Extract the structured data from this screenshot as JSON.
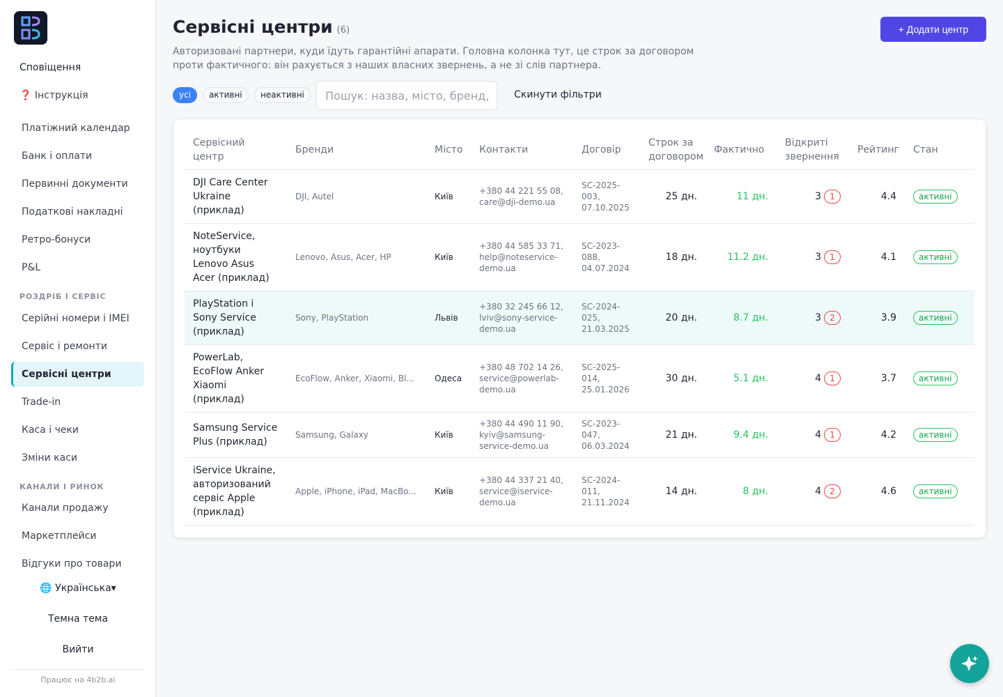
{
  "sidebar": {
    "notifications_label": "Сповіщення",
    "instructions_label": "❓ Інструкція",
    "finance_items": [
      {
        "label": "Платіжний календар"
      },
      {
        "label": "Банк і оплати"
      },
      {
        "label": "Первинні документи"
      },
      {
        "label": "Податкові накладні"
      },
      {
        "label": "Ретро-бонуси"
      },
      {
        "label": "P&L"
      }
    ],
    "section_retail": "РОЗДРІБ І СЕРВІС",
    "retail_items": [
      {
        "label": "Серійні номери і IMEI"
      },
      {
        "label": "Сервіс і ремонти"
      },
      {
        "label": "Сервісні центри"
      },
      {
        "label": "Trade-in"
      },
      {
        "label": "Каса і чеки"
      },
      {
        "label": "Зміни каси"
      }
    ],
    "section_channels": "КАНАЛИ І РИНОК",
    "channel_items": [
      {
        "label": "Канали продажу"
      },
      {
        "label": "Маркетплейси"
      },
      {
        "label": "Відгуки про товари"
      }
    ],
    "language": "🌐 Українська▾",
    "theme_label": "Темна тема",
    "logout_label": "Вийти",
    "powered_by": "Працює на 4b2b.ai"
  },
  "header": {
    "title": "Сервісні центри",
    "count": "(6)",
    "add_button": "+ Додати центр",
    "subtitle": "Авторизовані партнери, куди їдуть гарантійні апарати. Головна колонка тут, це строк за договором проти фактичного: він рахується з наших власних звернень, а не зі слів партнера."
  },
  "filters": {
    "chips": [
      "усі",
      "активні",
      "неактивні"
    ],
    "search_placeholder": "Пошук: назва, місто, бренд, ...",
    "search_value": "",
    "reset_label": "Скинути фільтри"
  },
  "table": {
    "columns": [
      "Сервісний центр",
      "Бренди",
      "Місто",
      "Контакти",
      "Договір",
      "Строк за договором",
      "Фактично",
      "Відкриті звернення",
      "Рейтинг",
      "Стан"
    ],
    "rows": [
      {
        "name": "DJI Care Center Ukraine (приклад)",
        "brands": "DJI, Autel",
        "city": "Київ",
        "contacts": "+380 44 221 55 08, care@dji-demo.ua",
        "contract": "SC-2025-003, 07.10.2025",
        "term": "25 дн.",
        "actual": "11 дн.",
        "open": "3",
        "overdue": "1",
        "rating": "4.4",
        "status": "активні"
      },
      {
        "name": "NoteService, ноутбуки Lenovo Asus Acer (приклад)",
        "brands": "Lenovo, Asus, Acer, HP",
        "city": "Київ",
        "contacts": "+380 44 585 33 71, help@noteservice-demo.ua",
        "contract": "SC-2023-088, 04.07.2024",
        "term": "18 дн.",
        "actual": "11.2 дн.",
        "open": "3",
        "overdue": "1",
        "rating": "4.1",
        "status": "активні"
      },
      {
        "name": "PlayStation і Sony Service (приклад)",
        "brands": "Sony, PlayStation",
        "city": "Львів",
        "contacts": "+380 32 245 66 12, lviv@sony-service-demo.ua",
        "contract": "SC-2024-025, 21.03.2025",
        "term": "20 дн.",
        "actual": "8.7 дн.",
        "open": "3",
        "overdue": "2",
        "rating": "3.9",
        "status": "активні"
      },
      {
        "name": "PowerLab, EcoFlow Anker Xiaomi (приклад)",
        "brands": "EcoFlow, Anker, Xiaomi, Bl...",
        "city": "Одеса",
        "contacts": "+380 48 702 14 26, service@powerlab-demo.ua",
        "contract": "SC-2025-014, 25.01.2026",
        "term": "30 дн.",
        "actual": "5.1 дн.",
        "open": "4",
        "overdue": "1",
        "rating": "3.7",
        "status": "активні"
      },
      {
        "name": "Samsung Service Plus (приклад)",
        "brands": "Samsung, Galaxy",
        "city": "Київ",
        "contacts": "+380 44 490 11 90, kyiv@samsung-service-demo.ua",
        "contract": "SC-2023-047, 06.03.2024",
        "term": "21 дн.",
        "actual": "9.4 дн.",
        "open": "4",
        "overdue": "1",
        "rating": "4.2",
        "status": "активні"
      },
      {
        "name": "iService Ukraine, авторизований сервіс Apple (приклад)",
        "brands": "Apple, iPhone, iPad, MacBo...",
        "city": "Київ",
        "contacts": "+380 44 337 21 40, service@iservice-demo.ua",
        "contract": "SC-2024-011, 21.11.2024",
        "term": "14 дн.",
        "actual": "8 дн.",
        "open": "4",
        "overdue": "2",
        "rating": "4.6",
        "status": "активні"
      }
    ]
  },
  "icons": {
    "logo": "4b2b-logo",
    "fab": "sparkle-icon"
  },
  "colors": {
    "accent": "#4f46e5",
    "active_chip": "#3b82f6",
    "status_green": "#22c55e",
    "overdue_red": "#ef4444",
    "fab": "#14a39a",
    "active_nav": "#e4f5fa"
  }
}
